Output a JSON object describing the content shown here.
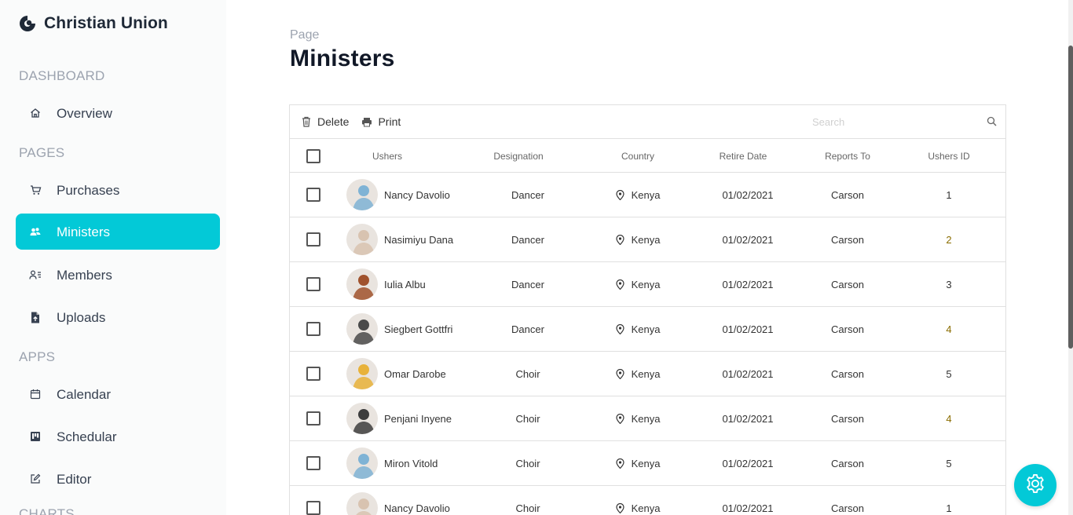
{
  "brand": {
    "name": "Christian Union",
    "icon": "brand-logo-icon"
  },
  "sidebar": {
    "sections": [
      {
        "title": "DASHBOARD",
        "items": [
          {
            "label": "Overview",
            "icon": "home-icon",
            "active": false
          }
        ]
      },
      {
        "title": "PAGES",
        "items": [
          {
            "label": "Purchases",
            "icon": "cart-icon",
            "active": false
          },
          {
            "label": "Ministers",
            "icon": "people-icon",
            "active": true
          },
          {
            "label": "Members",
            "icon": "user-list-icon",
            "active": false
          },
          {
            "label": "Uploads",
            "icon": "file-upload-icon",
            "active": false
          }
        ]
      },
      {
        "title": "APPS",
        "items": [
          {
            "label": "Calendar",
            "icon": "calendar-icon",
            "active": false
          },
          {
            "label": "Schedular",
            "icon": "kanban-icon",
            "active": false
          },
          {
            "label": "Editor",
            "icon": "edit-icon",
            "active": false
          }
        ]
      },
      {
        "title": "CHARTS",
        "items": []
      }
    ]
  },
  "page": {
    "label": "Page",
    "title": "Ministers"
  },
  "toolbar": {
    "delete_label": "Delete",
    "print_label": "Print",
    "search_placeholder": "Search"
  },
  "columns": [
    "Ushers",
    "Designation",
    "Country",
    "Retire Date",
    "Reports To",
    "Ushers ID"
  ],
  "rows": [
    {
      "name": "Nancy Davolio",
      "designation": "Dancer",
      "country": "Kenya",
      "retire": "01/02/2021",
      "reports_to": "Carson",
      "id": "1",
      "avatar": "#7fb3d5"
    },
    {
      "name": "Nasimiyu Dana",
      "designation": "Dancer",
      "country": "Kenya",
      "retire": "01/02/2021",
      "reports_to": "Carson",
      "id": "2",
      "avatar": "#d8c3b0"
    },
    {
      "name": "Iulia Albu",
      "designation": "Dancer",
      "country": "Kenya",
      "retire": "01/02/2021",
      "reports_to": "Carson",
      "id": "3",
      "avatar": "#a0522d"
    },
    {
      "name": "Siegbert Gottfri",
      "designation": "Dancer",
      "country": "Kenya",
      "retire": "01/02/2021",
      "reports_to": "Carson",
      "id": "4",
      "avatar": "#4a4a4a"
    },
    {
      "name": "Omar Darobe",
      "designation": "Choir",
      "country": "Kenya",
      "retire": "01/02/2021",
      "reports_to": "Carson",
      "id": "5",
      "avatar": "#e8b23a"
    },
    {
      "name": "Penjani Inyene",
      "designation": "Choir",
      "country": "Kenya",
      "retire": "01/02/2021",
      "reports_to": "Carson",
      "id": "4",
      "avatar": "#3d3d3d"
    },
    {
      "name": "Miron Vitold",
      "designation": "Choir",
      "country": "Kenya",
      "retire": "01/02/2021",
      "reports_to": "Carson",
      "id": "5",
      "avatar": "#7fb3d5"
    },
    {
      "name": "Nancy Davolio",
      "designation": "Choir",
      "country": "Kenya",
      "retire": "01/02/2021",
      "reports_to": "Carson",
      "id": "1",
      "avatar": "#d8c3b0"
    }
  ],
  "colors": {
    "accent": "#03c9d7",
    "id_even": "#8a6d00"
  },
  "settings": {
    "icon": "gear-icon"
  }
}
